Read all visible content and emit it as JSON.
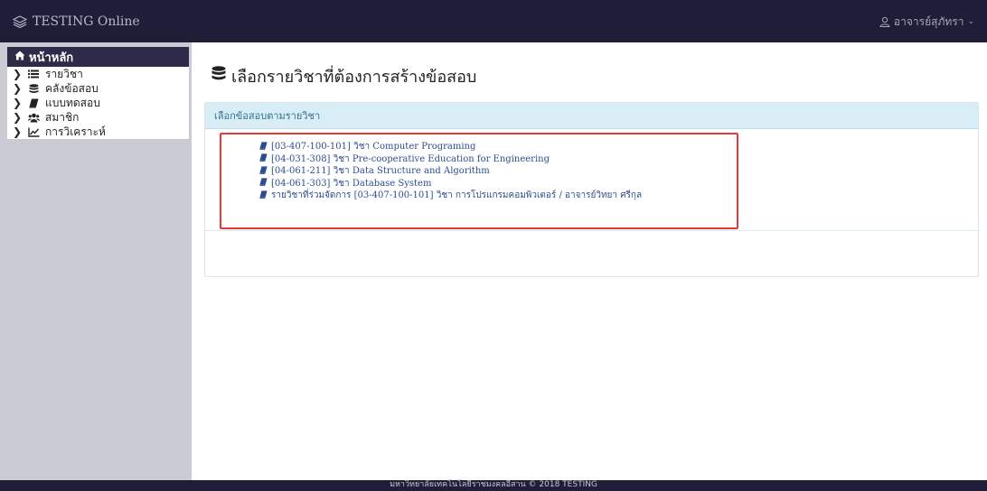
{
  "app": {
    "brand": "TESTING Online",
    "user_name": "อาจารย์สุภัทรา"
  },
  "sidebar": {
    "home_label": "หน้าหลัก",
    "items": [
      {
        "label": "รายวิชา",
        "icon": "list-icon"
      },
      {
        "label": "คลังข้อสอบ",
        "icon": "database-icon"
      },
      {
        "label": "แบบทดสอบ",
        "icon": "book-icon"
      },
      {
        "label": "สมาชิก",
        "icon": "users-icon"
      },
      {
        "label": "การวิเคราะห์",
        "icon": "chart-line-icon"
      }
    ]
  },
  "main": {
    "title": "เลือกรายวิชาที่ต้องการสร้างข้อสอบ",
    "panel_heading": "เลือกข้อสอบตามรายวิชา",
    "courses": [
      "[03-407-100-101] วิชา Computer Programing",
      "[04-031-308] วิชา Pre-cooperative Education for Engineering",
      "[04-061-211] วิชา Data Structure and Algorithm",
      "[04-061-303] วิชา Database System",
      "รายวิชาที่ร่วมจัดการ [03-407-100-101] วิชา การโปรแกรมคอมพิวเตอร์ / อาจารย์วิทยา ศรีกุล"
    ]
  },
  "footer": {
    "text": "มหาวิทยาลัยเทคโนโลยีราชมงคลอีสาน © 2018 TESTING"
  },
  "colors": {
    "navbar": "#1f1d38",
    "sidebar": "#cbcbd3",
    "panel_heading_bg": "#d9edf7",
    "link": "#2a4f8e",
    "highlight": "#e53935"
  }
}
